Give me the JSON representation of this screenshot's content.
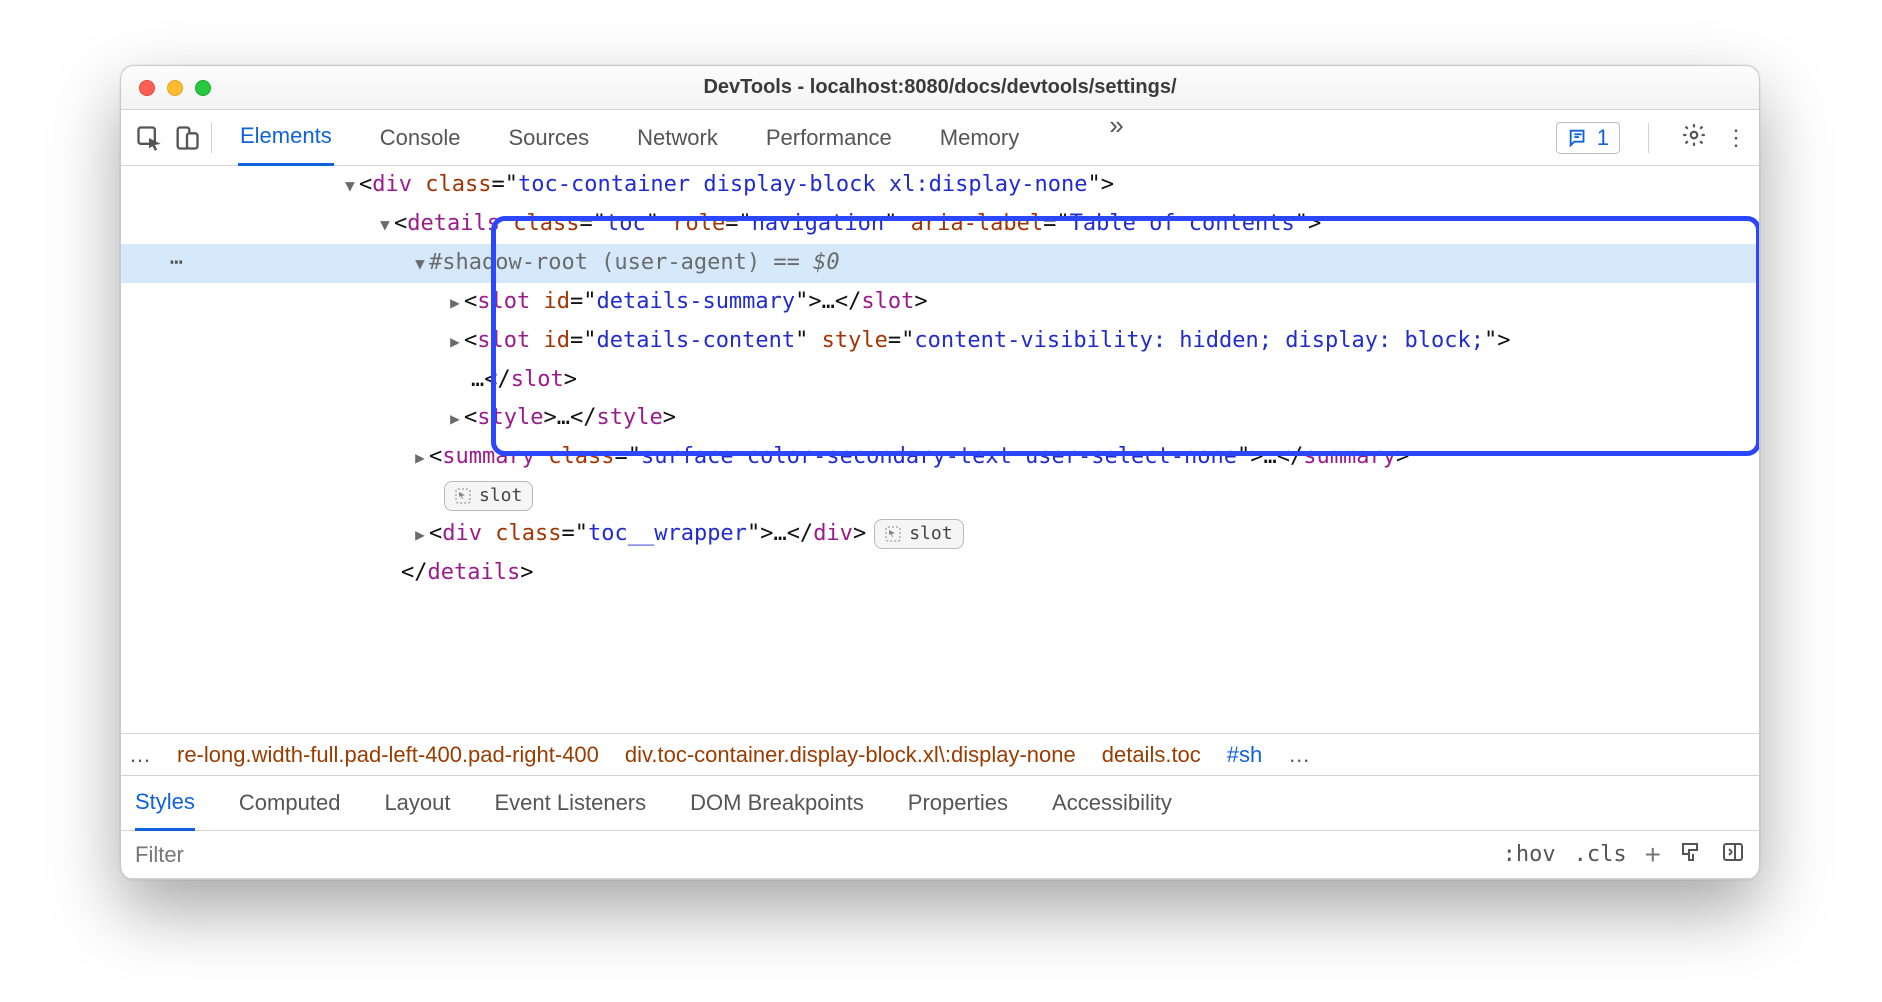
{
  "window": {
    "title": "DevTools - localhost:8080/docs/devtools/settings/"
  },
  "main_tabs": {
    "elements": "Elements",
    "console": "Console",
    "sources": "Sources",
    "network": "Network",
    "performance": "Performance",
    "memory": "Memory"
  },
  "badge_count": "1",
  "dom": {
    "gutter_ellipsis": "⋯",
    "l1_pre": "<",
    "l1_tag": "div",
    "l1_sp": " ",
    "l1_attr": "class",
    "l1_eq": "=\"",
    "l1_val": "toc-container display-block xl:display-none",
    "l1_post": "\">",
    "l2_pre": "<",
    "l2_tag": "details",
    "l2_sp": " ",
    "l2_a1": "class",
    "l2_v1": "toc",
    "l2_a2": "role",
    "l2_v2": "navigation",
    "l2_a3": "aria-label",
    "l2_v3": "Table of contents",
    "l2_post": "\">",
    "shadow_label": "#shadow-root (user-agent)",
    "shadow_eq": " == ",
    "shadow_ref": "$0",
    "slot1_pre": "<",
    "slot1_tag": "slot",
    "slot1_attr": "id",
    "slot1_val": "details-summary",
    "slot1_post": "\">",
    "ellips": "…",
    "slot1_close": "</",
    "slot1_close2": ">",
    "slot2_pre": "<",
    "slot2_tag": "slot",
    "slot2_a1": "id",
    "slot2_v1": "details-content",
    "slot2_a2": "style",
    "slot2_v2": "content-visibility: hidden; display: block;",
    "slot2_post": "\">",
    "slot2_close": "</",
    "slot2_close2": ">",
    "style_open": "<",
    "style_tag": "style",
    "style_mid": ">",
    "style_close": "</",
    "style_close2": ">",
    "summary_pre": "<",
    "summary_tag": "summary",
    "summary_attr": "class",
    "summary_val": "surface color-secondary-text user-select-none",
    "summary_post": "\">",
    "summary_close": "</",
    "summary_close2": ">",
    "slot_pill": "slot",
    "tocw_pre": "<",
    "tocw_tag": "div",
    "tocw_attr": "class",
    "tocw_val": "toc__wrapper",
    "tocw_post": "\">",
    "tocw_close": "</",
    "tocw_close2": ">",
    "details_close_pre": "</",
    "details_close_tag": "details",
    "details_close_post": ">"
  },
  "crumbs": {
    "ell1": "…",
    "c1": "re-long.width-full.pad-left-400.pad-right-400",
    "c2": "div.toc-container.display-block.xl\\:display-none",
    "c3": "details.toc",
    "c4": "#sh",
    "ell2": "…"
  },
  "styles_tabs": {
    "styles": "Styles",
    "computed": "Computed",
    "layout": "Layout",
    "event": "Event Listeners",
    "dom": "DOM Breakpoints",
    "props": "Properties",
    "acc": "Accessibility"
  },
  "filter": {
    "placeholder": "Filter",
    "hov": ":hov",
    "cls": ".cls"
  }
}
